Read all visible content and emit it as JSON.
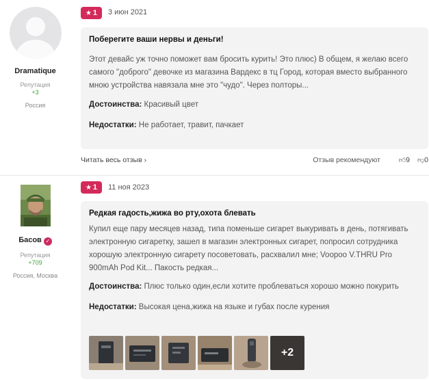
{
  "reviews": [
    {
      "user": {
        "name": "Dramatique",
        "reputation_label": "Репутация",
        "reputation_value": "+3",
        "location": "Россия"
      },
      "rating": "1",
      "date": "3 июн 2021",
      "title": "Поберегите ваши нервы и деньги!",
      "text": "Этот девайс уж точно поможет вам бросить курить! Это плюс) В общем, я желаю всего самого \"доброго\" девочке из магазина Вардекс в тц Город, которая вместо выбранного мною устройства навязала мне это \"чудо\". Через полторы...",
      "pros_label": "Достоинства:",
      "pros": "Красивый цвет",
      "cons_label": "Недостатки:",
      "cons": "Не работает, травит, пачкает",
      "read_more": "Читать весь отзыв",
      "recommend": "Отзыв рекомендуют",
      "likes": "9",
      "dislikes": "0"
    },
    {
      "user": {
        "name": "Басов",
        "reputation_label": "Репутация",
        "reputation_value": "+709",
        "location": "Россия, Москва"
      },
      "rating": "1",
      "date": "11 ноя 2023",
      "title": "Редкая гадость,жижа во рту,охота блевать",
      "text": "Купил еще пару месяцев назад, типа поменьше сигарет выкуривать в день, потягивать электронную сигаретку, зашел в магазин электронных сигарет, попросил сотрудника хорошую электронную сигарету посоветовать, расхвалил мне; Voopoo V.THRU Pro 900mAh Pod Kit... Пакость редкая...",
      "pros_label": "Достоинства:",
      "pros": "Плюс только один,если хотите проблеваться хорошо можно покурить",
      "cons_label": "Недостатки:",
      "cons": "Высокая цена,жижа на языке и губах после курения",
      "more_photos": "+2"
    }
  ],
  "colors": {
    "accent": "#d42a5a",
    "reputation": "#3da53d",
    "card_bg": "#f3f3f3"
  }
}
